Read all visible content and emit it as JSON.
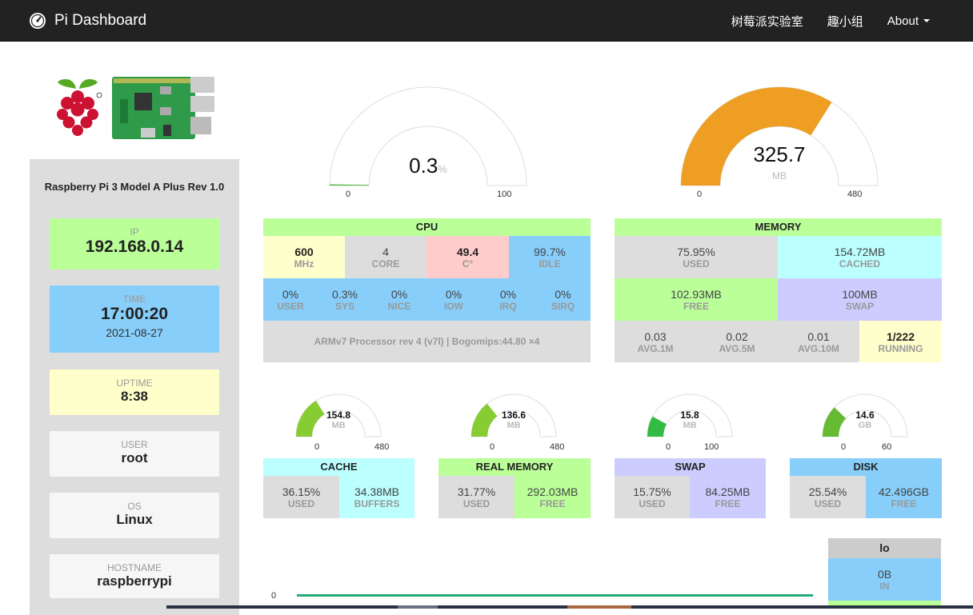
{
  "nav": {
    "brand": "Pi Dashboard",
    "links": [
      "树莓派实验室",
      "趣小组",
      "About"
    ]
  },
  "system": {
    "model": "Raspberry Pi 3 Model A Plus Rev 1.0",
    "ip_label": "IP",
    "ip": "192.168.0.14",
    "time_label": "TIME",
    "time": "17:00:20",
    "date": "2021-08-27",
    "uptime_label": "UPTIME",
    "uptime": "8:38",
    "user_label": "USER",
    "user": "root",
    "os_label": "OS",
    "os": "Linux",
    "hostname_label": "HOSTNAME",
    "hostname": "raspberrypi"
  },
  "cpu_gauge": {
    "value": "0.3",
    "unit": "%",
    "min": "0",
    "max": "100",
    "level": 0.003,
    "color": "#55bb44"
  },
  "mem_gauge": {
    "value": "325.7",
    "unit": "MB",
    "min": "0",
    "max": "480",
    "level": 0.6785,
    "color": "#ee9e22"
  },
  "cpu": {
    "title": "CPU",
    "row1": [
      {
        "n": "600",
        "l": "MHz"
      },
      {
        "n": "4",
        "l": "CORE"
      },
      {
        "n": "49.4",
        "l": "C°"
      },
      {
        "n": "99.7%",
        "l": "IDLE"
      }
    ],
    "row2": [
      {
        "n": "0%",
        "l": "USER"
      },
      {
        "n": "0.3%",
        "l": "SYS"
      },
      {
        "n": "0%",
        "l": "NICE"
      },
      {
        "n": "0%",
        "l": "IOW"
      },
      {
        "n": "0%",
        "l": "IRQ"
      },
      {
        "n": "0%",
        "l": "SIRQ"
      }
    ],
    "processor": "ARMv7 Processor rev 4 (v7l) | Bogomips:44.80 ×4"
  },
  "memory": {
    "title": "MEMORY",
    "used": {
      "n": "75.95%",
      "l": "USED"
    },
    "cached": {
      "n": "154.72MB",
      "l": "CACHED"
    },
    "free": {
      "n": "102.93MB",
      "l": "FREE"
    },
    "swap": {
      "n": "100MB",
      "l": "SWAP"
    },
    "load": [
      {
        "n": "0.03",
        "l": "AVG.1M"
      },
      {
        "n": "0.02",
        "l": "AVG.5M"
      },
      {
        "n": "0.01",
        "l": "AVG.10M"
      },
      {
        "n": "1/222",
        "l": "RUNNING"
      }
    ]
  },
  "small_gauges": [
    {
      "value": "154.8",
      "unit": "MB",
      "min": "0",
      "max": "480",
      "level": 0.3225,
      "color": "#88cc33"
    },
    {
      "value": "136.6",
      "unit": "MB",
      "min": "0",
      "max": "480",
      "level": 0.2846,
      "color": "#88cc33"
    },
    {
      "value": "15.8",
      "unit": "MB",
      "min": "0",
      "max": "100",
      "level": 0.158,
      "color": "#33bb44"
    },
    {
      "value": "14.6",
      "unit": "GB",
      "min": "0",
      "max": "60",
      "level": 0.2433,
      "color": "#66bb33"
    }
  ],
  "cache": {
    "title": "CACHE",
    "a": {
      "n": "36.15%",
      "l": "USED"
    },
    "b": {
      "n": "34.38MB",
      "l": "BUFFERS"
    }
  },
  "realmem": {
    "title": "REAL MEMORY",
    "a": {
      "n": "31.77%",
      "l": "USED"
    },
    "b": {
      "n": "292.03MB",
      "l": "FREE"
    }
  },
  "swap": {
    "title": "SWAP",
    "a": {
      "n": "15.75%",
      "l": "USED"
    },
    "b": {
      "n": "84.25MB",
      "l": "FREE"
    }
  },
  "disk": {
    "title": "DISK",
    "a": {
      "n": "25.54%",
      "l": "USED"
    },
    "b": {
      "n": "42.496GB",
      "l": "FREE"
    }
  },
  "net": {
    "axis_zero": "0",
    "iface": "lo",
    "in_value": "0B",
    "in_label": "IN",
    "line_color": "#22aa77"
  }
}
